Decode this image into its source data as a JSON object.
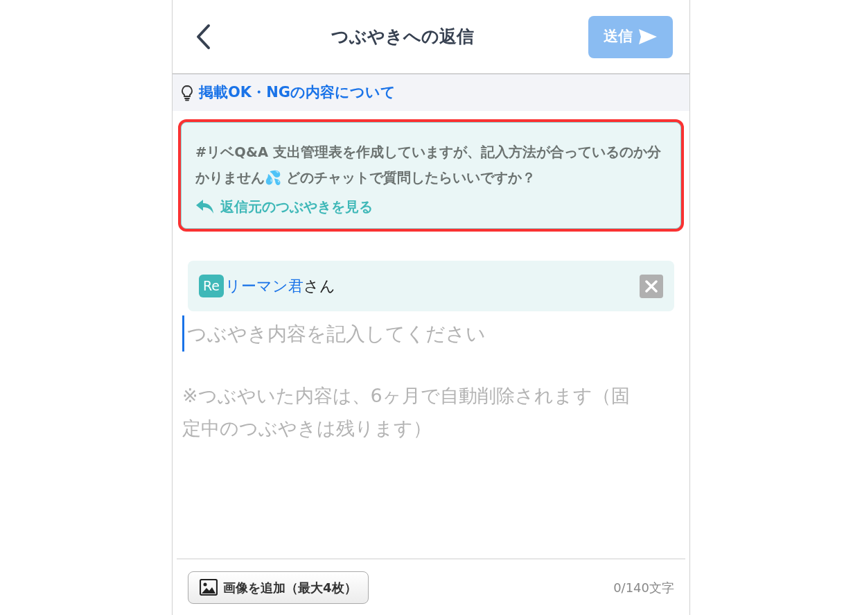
{
  "header": {
    "title": "つぶやきへの返信",
    "send_button": {
      "label": "送信",
      "disabled": true
    }
  },
  "notice": {
    "label": "掲載OK・NGの内容について"
  },
  "quoted_post": {
    "text": "#リベQ&A  支出管理表を作成していますが、記入方法が合っているのか分かりません💦 どのチャットで質問したらいいですか？",
    "link": "返信元のつぶやきを見る",
    "highlighted": true
  },
  "reply_to": {
    "badge": "Re",
    "name": "リーマン君",
    "suffix": "さん"
  },
  "compose": {
    "placeholder": "つぶやき内容を記入してください",
    "note": "※つぶやいた内容は、6ヶ月で自動削除されます（固定中のつぶやきは残ります）"
  },
  "footer": {
    "add_image_button": "画像を追加（最大4枚）",
    "counter": "0/140文字"
  }
}
